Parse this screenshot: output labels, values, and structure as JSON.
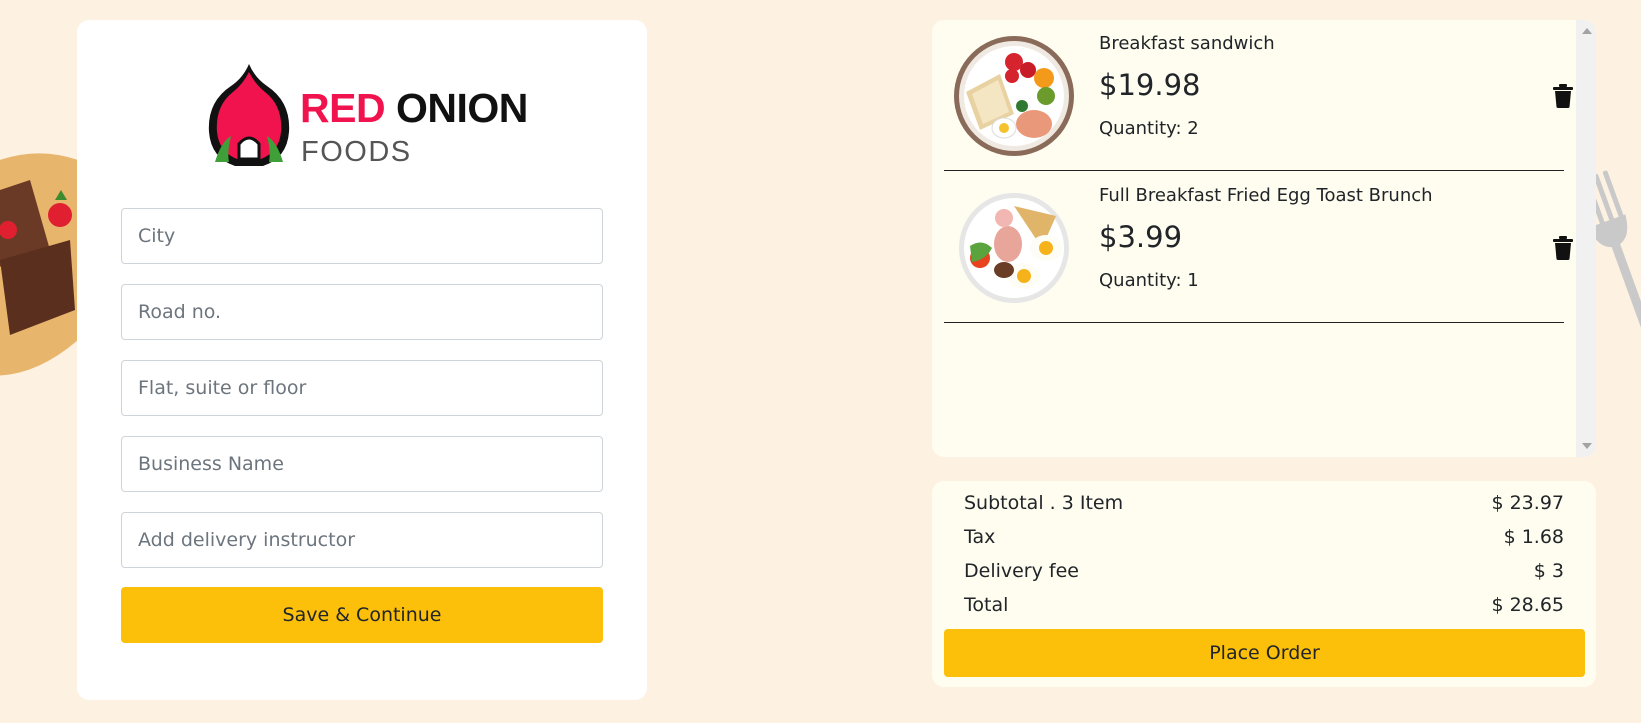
{
  "brand": {
    "word_red": "RED",
    "word_black": "ONION",
    "word_sub": "FOODS",
    "colors": {
      "red": "#f0134d",
      "black": "#111111",
      "sub": "#555555"
    }
  },
  "form": {
    "fields": [
      {
        "placeholder": "City",
        "value": ""
      },
      {
        "placeholder": "Road no.",
        "value": ""
      },
      {
        "placeholder": "Flat, suite or floor",
        "value": ""
      },
      {
        "placeholder": "Business Name",
        "value": ""
      },
      {
        "placeholder": "Add delivery instructor",
        "value": ""
      }
    ],
    "submit_label": "Save & Continue"
  },
  "cart": {
    "items": [
      {
        "name": "Breakfast sandwich",
        "price": "$19.98",
        "quantity": "Quantity: 2",
        "image_icon": "breakfast-plate-icon"
      },
      {
        "name": "Full Breakfast Fried Egg Toast Brunch",
        "price": "$3.99",
        "quantity": "Quantity: 1",
        "image_icon": "fried-egg-plate-icon"
      }
    ],
    "remove_icon": "trash-icon"
  },
  "summary": {
    "rows": [
      {
        "label": "Subtotal . 3 Item",
        "value": "$ 23.97"
      },
      {
        "label": "Tax",
        "value": "$ 1.68"
      },
      {
        "label": "Delivery fee",
        "value": "$ 3"
      },
      {
        "label": "Total",
        "value": "$ 28.65"
      }
    ],
    "place_order_label": "Place Order"
  },
  "theme": {
    "background": "#fdf1e1",
    "panel": "#fefdef",
    "accent": "#fcc00b"
  }
}
